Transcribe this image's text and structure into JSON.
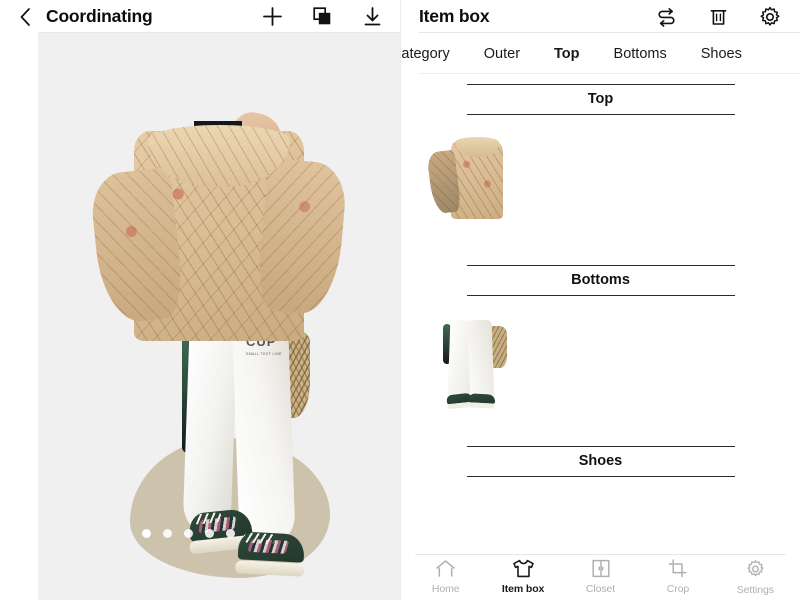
{
  "left_panel": {
    "header": {
      "back_icon": "chevron-left-icon",
      "title": "Coordinating",
      "actions": [
        {
          "name": "add-item-button",
          "icon": "plus-icon"
        },
        {
          "name": "duplicate-layer-button",
          "icon": "layers-copy-icon"
        },
        {
          "name": "download-button",
          "icon": "download-icon"
        }
      ]
    },
    "canvas": {
      "background_color": "#f0f0f0",
      "pagination": {
        "total": 5,
        "active_index": 0
      }
    }
  },
  "right_panel": {
    "header": {
      "title": "Item box",
      "actions": [
        {
          "name": "swap-button",
          "icon": "swap-arrows-icon"
        },
        {
          "name": "delete-button",
          "icon": "trash-icon"
        },
        {
          "name": "settings-button",
          "icon": "gear-icon"
        }
      ]
    },
    "tabs": [
      {
        "label": "All category",
        "active": false
      },
      {
        "label": "Outer",
        "active": false
      },
      {
        "label": "Top",
        "active": true
      },
      {
        "label": "Bottoms",
        "active": false
      },
      {
        "label": "Shoes",
        "active": false
      }
    ],
    "sections": [
      {
        "title": "Top",
        "items": [
          {
            "name": "floral-blouse-thumbnail"
          }
        ]
      },
      {
        "title": "Bottoms",
        "items": [
          {
            "name": "white-pants-thumbnail"
          }
        ]
      },
      {
        "title": "Shoes",
        "items": []
      }
    ]
  },
  "bottom_nav": {
    "items": [
      {
        "label": "Home",
        "icon": "home-icon",
        "active": false
      },
      {
        "label": "Item box",
        "icon": "tshirt-icon",
        "active": true
      },
      {
        "label": "Closet",
        "icon": "wardrobe-icon",
        "active": false
      },
      {
        "label": "Crop",
        "icon": "crop-icon",
        "active": false
      },
      {
        "label": "Settings",
        "icon": "gear-icon",
        "active": false
      }
    ]
  },
  "colors": {
    "canvas_bg": "#f0f0f0",
    "text_primary": "#121212",
    "text_muted": "#b0b0b0",
    "divider": "#e6e6e6"
  }
}
